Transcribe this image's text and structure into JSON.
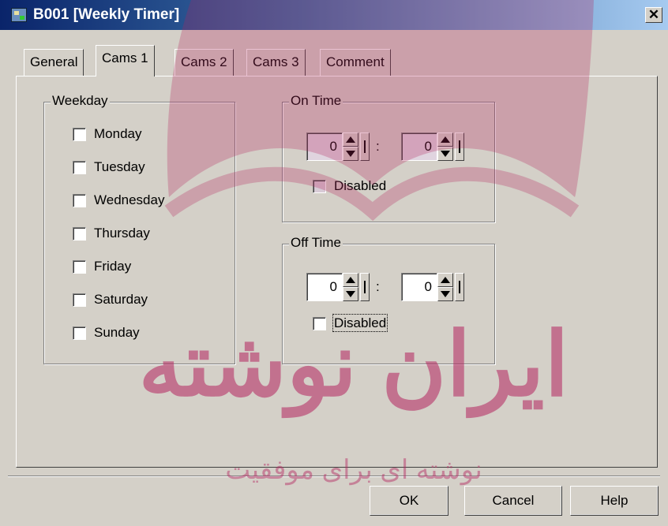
{
  "window": {
    "title": "B001 [Weekly Timer]",
    "close_symbol": "✕"
  },
  "tabs": [
    {
      "label": "General",
      "active": false
    },
    {
      "label": "Cams 1",
      "active": true
    },
    {
      "label": "Cams 2",
      "active": false
    },
    {
      "label": "Cams 3",
      "active": false
    },
    {
      "label": "Comment",
      "active": false
    }
  ],
  "weekday": {
    "legend": "Weekday",
    "days": [
      {
        "label": "Monday",
        "checked": false
      },
      {
        "label": "Tuesday",
        "checked": false
      },
      {
        "label": "Wednesday",
        "checked": false
      },
      {
        "label": "Thursday",
        "checked": false
      },
      {
        "label": "Friday",
        "checked": false
      },
      {
        "label": "Saturday",
        "checked": false
      },
      {
        "label": "Sunday",
        "checked": false
      }
    ]
  },
  "on_time": {
    "legend": "On Time",
    "hours": "0",
    "minutes": "0",
    "separator": ":",
    "disabled_label": "Disabled",
    "disabled": false
  },
  "off_time": {
    "legend": "Off Time",
    "hours": "0",
    "minutes": "0",
    "separator": ":",
    "disabled_label": "Disabled",
    "disabled": false
  },
  "buttons": {
    "ok": "OK",
    "cancel": "Cancel",
    "help": "Help"
  },
  "watermark": {
    "text_large": "ایران نوشته",
    "text_small": "نوشته ای برای موفقیت",
    "color": "#b5245f"
  },
  "colors": {
    "title_start": "#0a246a",
    "title_end": "#a6caf0",
    "face": "#d4d0c8"
  }
}
